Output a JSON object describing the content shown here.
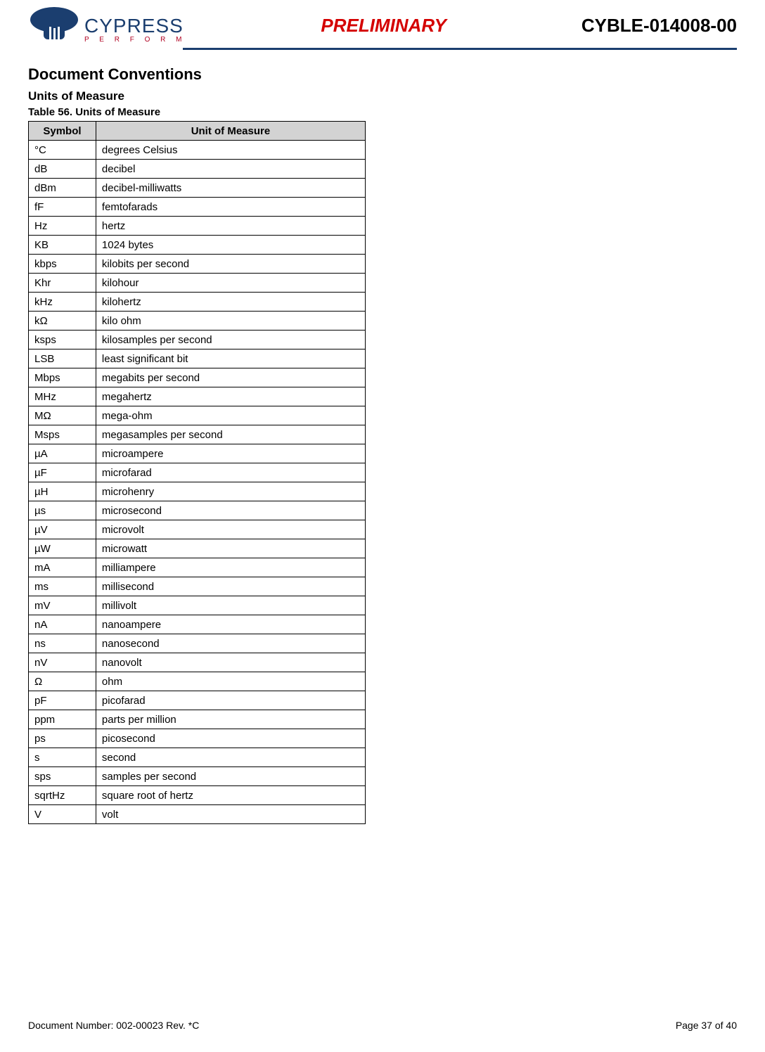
{
  "header": {
    "brand_main": "CYPRESS",
    "brand_sub": "P E R F O R M",
    "center": "PRELIMINARY",
    "right": "CYBLE-014008-00"
  },
  "section": {
    "h1": "Document Conventions",
    "h2": "Units of Measure",
    "table_caption": "Table 56.  Units of Measure"
  },
  "table": {
    "headers": {
      "c1": "Symbol",
      "c2": "Unit of Measure"
    },
    "rows": [
      {
        "sym": "°C",
        "unit": "degrees Celsius"
      },
      {
        "sym": "dB",
        "unit": "decibel"
      },
      {
        "sym": "dBm",
        "unit": "decibel-milliwatts"
      },
      {
        "sym": "fF",
        "unit": "femtofarads"
      },
      {
        "sym": "Hz",
        "unit": "hertz"
      },
      {
        "sym": "KB",
        "unit": "1024 bytes"
      },
      {
        "sym": "kbps",
        "unit": "kilobits per second"
      },
      {
        "sym": "Khr",
        "unit": "kilohour"
      },
      {
        "sym": "kHz",
        "unit": "kilohertz"
      },
      {
        "sym": "kΩ",
        "unit": "kilo ohm"
      },
      {
        "sym": "ksps",
        "unit": "kilosamples per second"
      },
      {
        "sym": "LSB",
        "unit": "least significant bit"
      },
      {
        "sym": "Mbps",
        "unit": "megabits per second"
      },
      {
        "sym": "MHz",
        "unit": "megahertz"
      },
      {
        "sym": "MΩ",
        "unit": "mega-ohm"
      },
      {
        "sym": "Msps",
        "unit": "megasamples per second"
      },
      {
        "sym": "µA",
        "unit": "microampere"
      },
      {
        "sym": "µF",
        "unit": "microfarad"
      },
      {
        "sym": "µH",
        "unit": "microhenry"
      },
      {
        "sym": "µs",
        "unit": "microsecond"
      },
      {
        "sym": "µV",
        "unit": "microvolt"
      },
      {
        "sym": "µW",
        "unit": "microwatt"
      },
      {
        "sym": "mA",
        "unit": "milliampere"
      },
      {
        "sym": "ms",
        "unit": "millisecond"
      },
      {
        "sym": "mV",
        "unit": "millivolt"
      },
      {
        "sym": "nA",
        "unit": "nanoampere"
      },
      {
        "sym": "ns",
        "unit": "nanosecond"
      },
      {
        "sym": "nV",
        "unit": "nanovolt"
      },
      {
        "sym": "Ω",
        "unit": "ohm"
      },
      {
        "sym": "pF",
        "unit": "picofarad"
      },
      {
        "sym": "ppm",
        "unit": "parts per million"
      },
      {
        "sym": "ps",
        "unit": "picosecond"
      },
      {
        "sym": "s",
        "unit": "second"
      },
      {
        "sym": "sps",
        "unit": "samples per second"
      },
      {
        "sym": "sqrtHz",
        "unit": "square root of hertz"
      },
      {
        "sym": "V",
        "unit": "volt"
      }
    ]
  },
  "footer": {
    "left": "Document Number: 002-00023 Rev. *C",
    "right": "Page 37 of 40"
  }
}
